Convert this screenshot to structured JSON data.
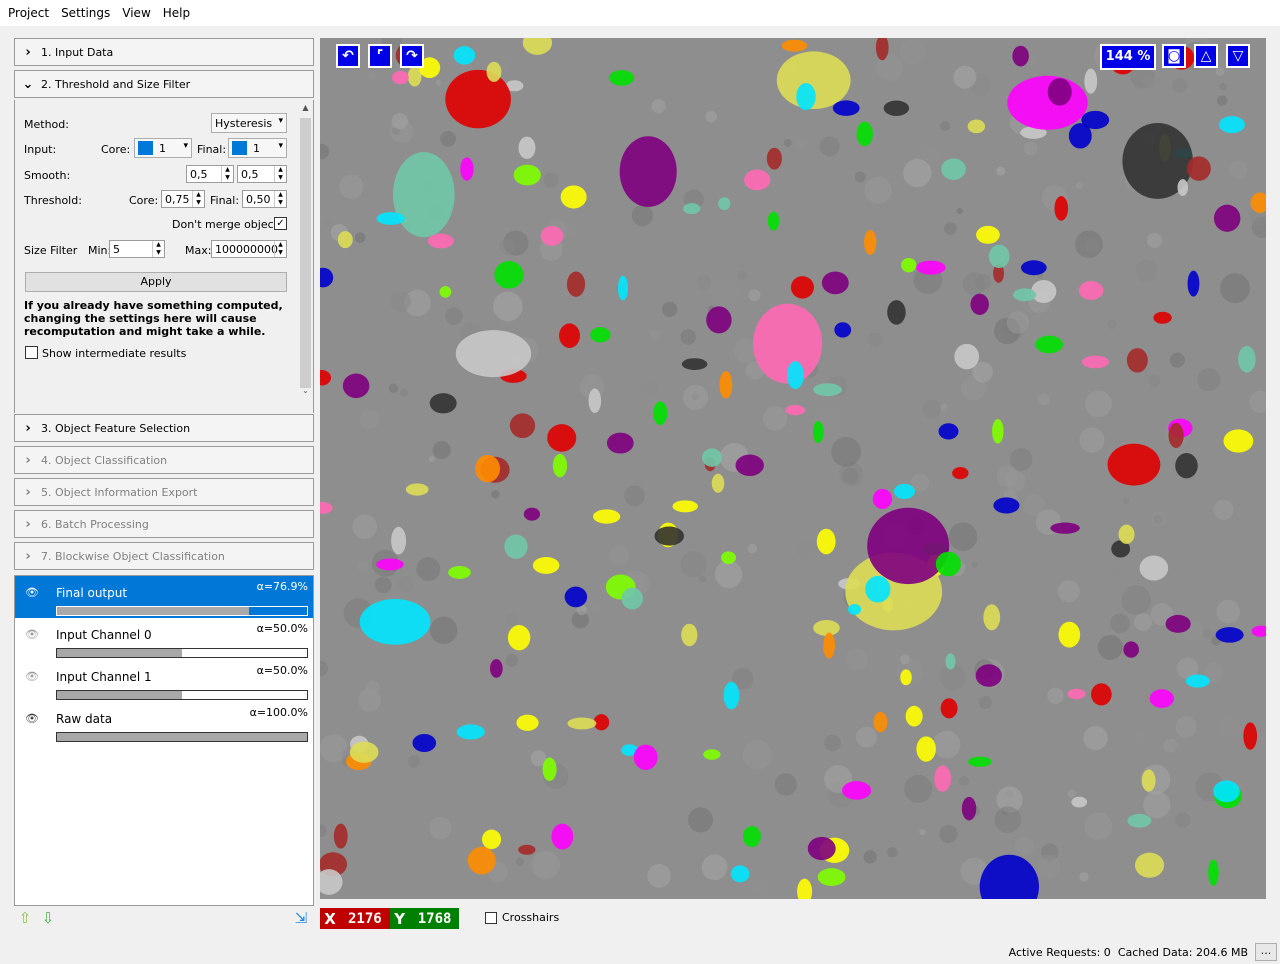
{
  "menu": [
    "Project",
    "Settings",
    "View",
    "Help"
  ],
  "applets": [
    {
      "label": "1. Input Data",
      "expanded": false,
      "enabled": true
    },
    {
      "label": "2. Threshold and Size Filter",
      "expanded": true,
      "enabled": true
    },
    {
      "label": "3. Object Feature Selection",
      "expanded": false,
      "enabled": true
    },
    {
      "label": "4. Object Classification",
      "expanded": false,
      "enabled": false
    },
    {
      "label": "5. Object Information Export",
      "expanded": false,
      "enabled": false
    },
    {
      "label": "6. Batch Processing",
      "expanded": false,
      "enabled": false
    },
    {
      "label": "7. Blockwise Object Classification",
      "expanded": false,
      "enabled": false
    }
  ],
  "threshold": {
    "method_label": "Method:",
    "method_value": "Hysteresis",
    "input_label": "Input:",
    "core_label": "Core:",
    "core_channel": "1",
    "final_label": "Final:",
    "final_channel": "1",
    "smooth_label": "Smooth:",
    "smooth_x": "0,5",
    "smooth_y": "0,5",
    "threshold_label": "Threshold:",
    "threshold_core_label": "Core:",
    "threshold_core": "0,75",
    "threshold_final_label": "Final:",
    "threshold_final": "0,50",
    "dont_merge_label": "Don't merge objects",
    "dont_merge_checked": true,
    "size_filter_label": "Size Filter",
    "min_label": "Min:",
    "min_value": "5",
    "max_label": "Max:",
    "max_value": "100000000",
    "apply_label": "Apply",
    "warning": "If you already have something computed, changing the settings here will cause recomputation and might take a while.",
    "show_intermediate_label": "Show intermediate results",
    "show_intermediate_checked": false
  },
  "layers": [
    {
      "name": "Final output",
      "opacity_label": "α=76.9%",
      "opacity": 0.769,
      "visible": true,
      "selected": true
    },
    {
      "name": "Input Channel 0",
      "opacity_label": "α=50.0%",
      "opacity": 0.5,
      "visible": false,
      "selected": false
    },
    {
      "name": "Input Channel 1",
      "opacity_label": "α=50.0%",
      "opacity": 0.5,
      "visible": false,
      "selected": false
    },
    {
      "name": "Raw data",
      "opacity_label": "α=100.0%",
      "opacity": 1.0,
      "visible": true,
      "selected": false
    }
  ],
  "viewer": {
    "zoom": "144 %",
    "icons": [
      "undo-icon",
      "fit-view-icon",
      "redo-icon",
      "camera-icon",
      "triangle-up-icon",
      "triangle-down-icon"
    ]
  },
  "coords": {
    "x_letter": "X",
    "x_value": "2176",
    "y_letter": "Y",
    "y_value": "1768",
    "x_color": "#c00000",
    "y_color": "#008000"
  },
  "crosshairs_label": "Crosshairs",
  "status": {
    "active_requests": "Active Requests: 0",
    "cached_data": "Cached Data: 204.6 MB",
    "button": "..."
  }
}
